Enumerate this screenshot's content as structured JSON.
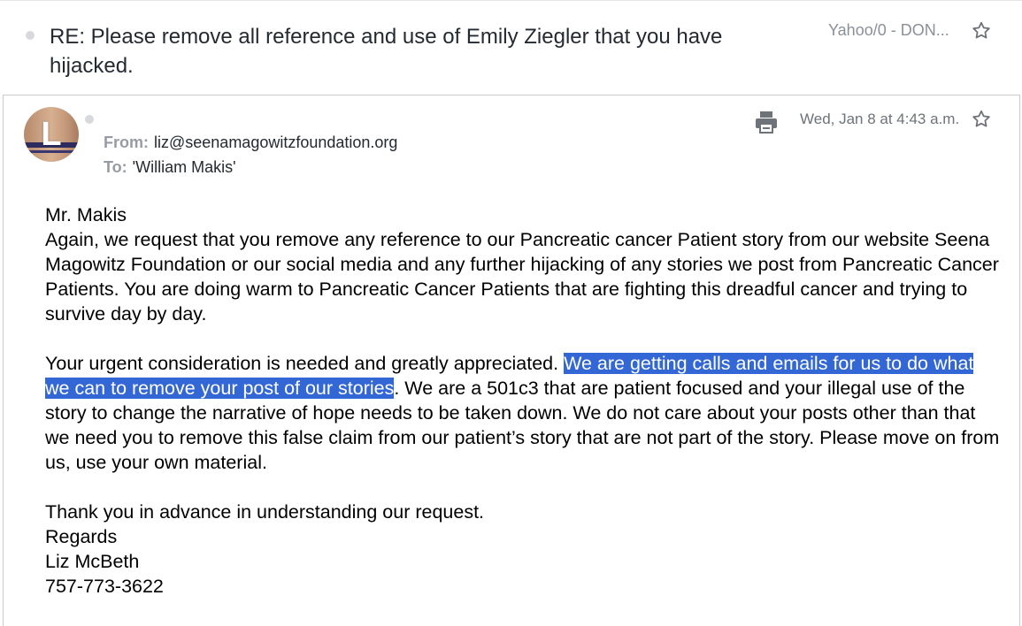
{
  "thread": {
    "subject": "RE: Please remove all reference and use of Emily Ziegler that you have hijacked.",
    "folder": "Yahoo/0 - DON..."
  },
  "message": {
    "avatar_letter": "L",
    "date": "Wed, Jan 8 at 4:43 a.m.",
    "from_label": "From:",
    "from_value": "liz@seenamagowitzfoundation.org",
    "to_label": "To:",
    "to_value": "'William Makis'",
    "body": {
      "greeting": "Mr. Makis",
      "para1": "Again, we request that you remove any reference to our Pancreatic cancer Patient story from our website Seena Magowitz Foundation or our social media and any further hijacking of any stories we post from Pancreatic Cancer Patients.  You are doing warm to Pancreatic Cancer Patients that are fighting this dreadful cancer and trying to survive day by day.",
      "para2_start": "Your urgent consideration is needed and greatly appreciated.  ",
      "para2_highlight": "We are getting calls and emails for us to do what we can to remove your post of our stories",
      "para2_end": ".  We are a 501c3 that are patient focused and your illegal use of the story to change the narrative of hope needs to be taken down.  We do not care about your posts other than that we need you to remove this false claim from our patient’s story that are not part of the story.  Please move on from us, use your own material.",
      "thanks": "Thank you in advance in understanding our request.",
      "closing": "Regards",
      "name": "Liz McBeth",
      "phone": "757-773-3622"
    }
  },
  "colors": {
    "highlight": "#3367d6",
    "label_gray": "#979ba3",
    "date_gray": "#6e7379"
  },
  "icons": [
    "star-icon",
    "printer-icon",
    "unread-dot-icon",
    "avatar"
  ]
}
